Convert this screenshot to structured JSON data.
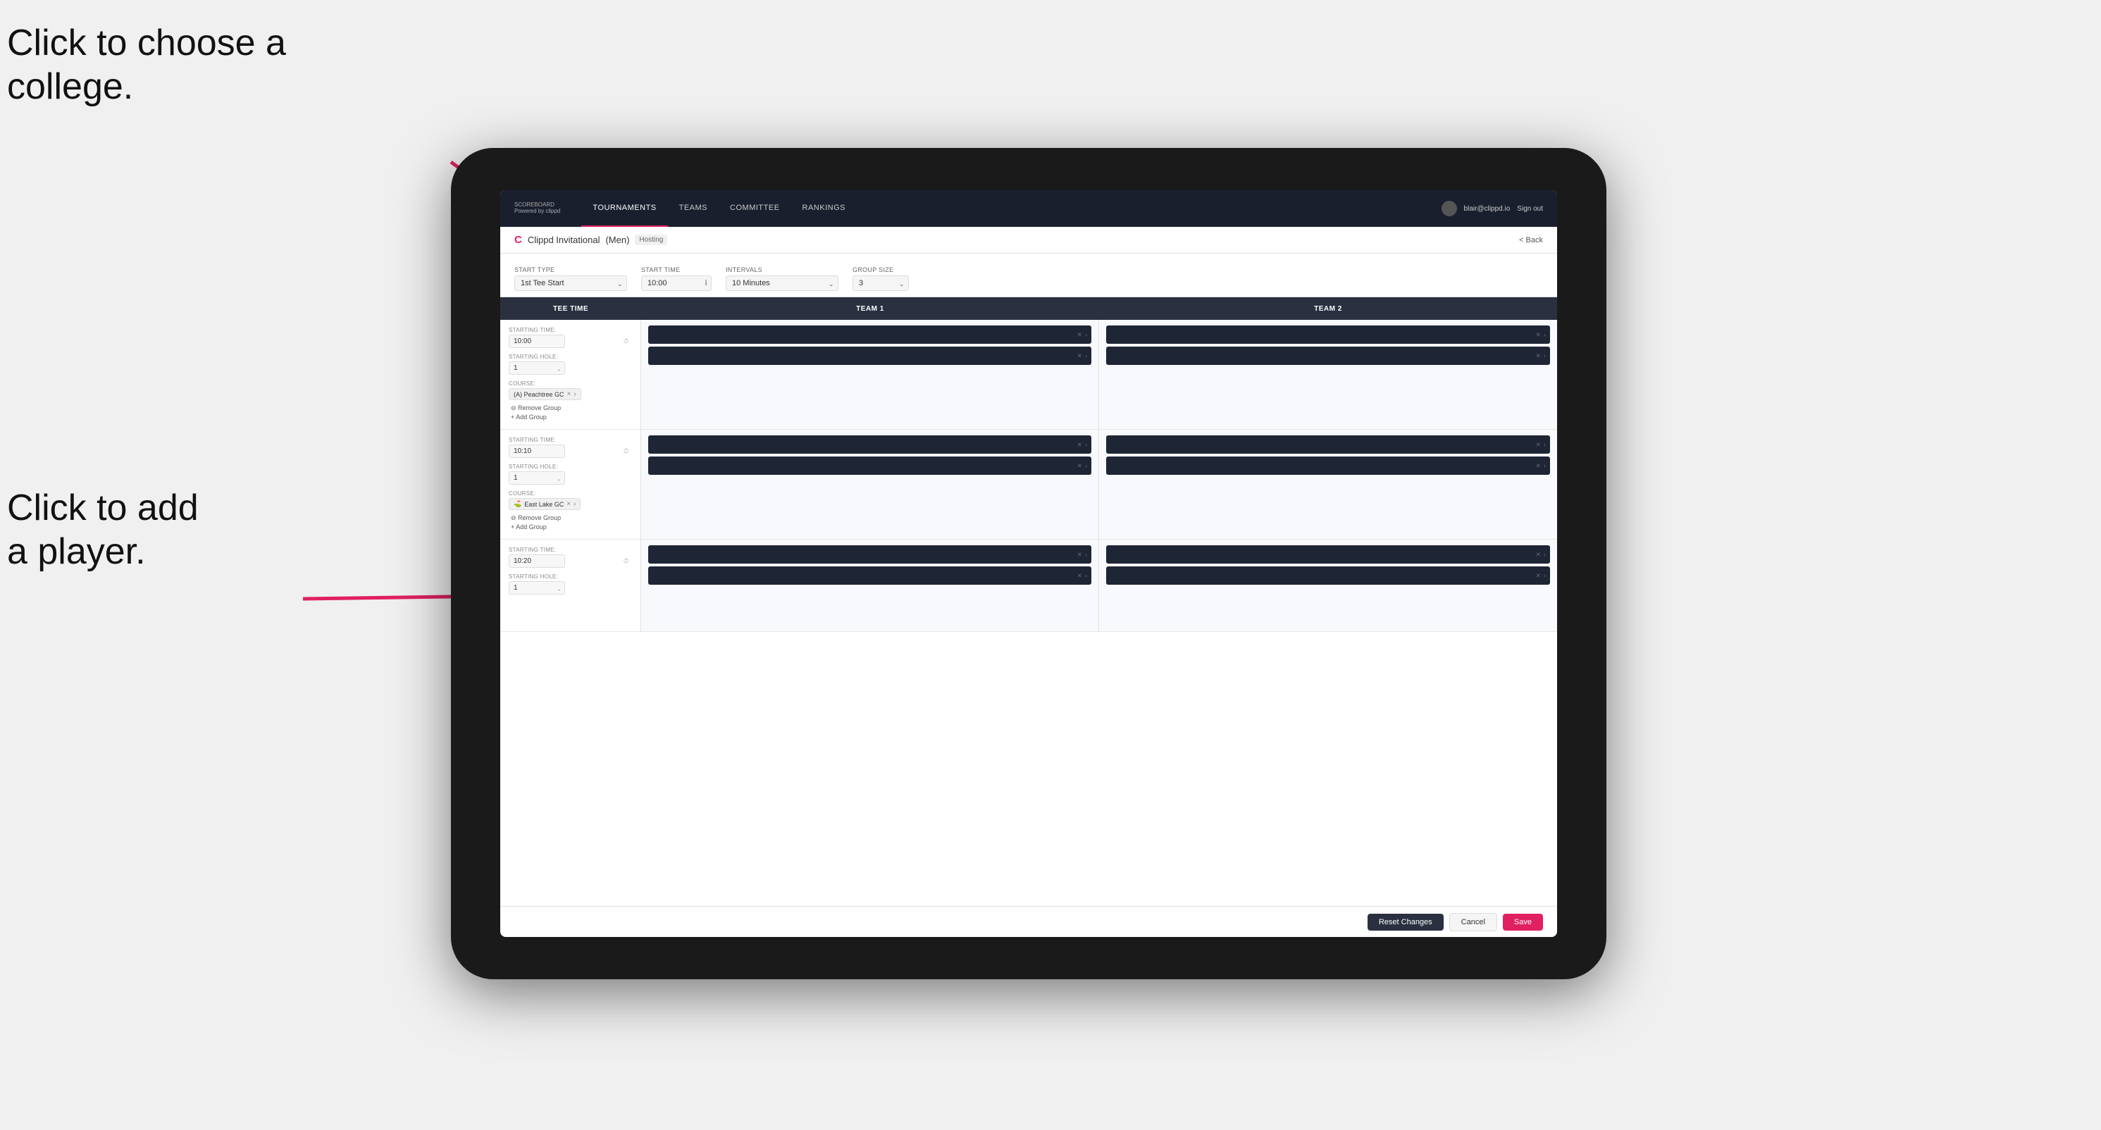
{
  "annotations": {
    "text1_line1": "Click to choose a",
    "text1_line2": "college.",
    "text2_line1": "Click to add",
    "text2_line2": "a player."
  },
  "header": {
    "logo": "SCOREBOARD",
    "logo_sub": "Powered by clippd",
    "nav_tabs": [
      {
        "label": "TOURNAMENTS",
        "active": true
      },
      {
        "label": "TEAMS",
        "active": false
      },
      {
        "label": "COMMITTEE",
        "active": false
      },
      {
        "label": "RANKINGS",
        "active": false
      }
    ],
    "user_email": "blair@clippd.io",
    "sign_out": "Sign out"
  },
  "sub_header": {
    "logo": "C",
    "tournament_name": "Clippd Invitational",
    "gender": "(Men)",
    "hosting_label": "Hosting",
    "back_label": "< Back"
  },
  "settings": {
    "start_type_label": "Start Type",
    "start_type_value": "1st Tee Start",
    "start_time_label": "Start Time",
    "start_time_value": "10:00",
    "intervals_label": "Intervals",
    "intervals_value": "10 Minutes",
    "group_size_label": "Group Size",
    "group_size_value": "3"
  },
  "table": {
    "col1": "Tee Time",
    "col2": "Team 1",
    "col3": "Team 2"
  },
  "tee_times": [
    {
      "starting_time_label": "STARTING TIME:",
      "starting_time": "10:00",
      "starting_hole_label": "STARTING HOLE:",
      "starting_hole": "1",
      "course_label": "COURSE:",
      "course": "(A) Peachtree GC",
      "remove_group": "Remove Group",
      "add_group": "Add Group",
      "team1_slots": 2,
      "team2_slots": 2
    },
    {
      "starting_time_label": "STARTING TIME:",
      "starting_time": "10:10",
      "starting_hole_label": "STARTING HOLE:",
      "starting_hole": "1",
      "course_label": "COURSE:",
      "course": "East Lake GC",
      "remove_group": "Remove Group",
      "add_group": "Add Group",
      "team1_slots": 2,
      "team2_slots": 2
    },
    {
      "starting_time_label": "STARTING TIME:",
      "starting_time": "10:20",
      "starting_hole_label": "STARTING HOLE:",
      "starting_hole": "1",
      "course_label": "",
      "course": "",
      "remove_group": "",
      "add_group": "",
      "team1_slots": 2,
      "team2_slots": 2
    }
  ],
  "footer": {
    "reset_label": "Reset Changes",
    "cancel_label": "Cancel",
    "save_label": "Save"
  }
}
